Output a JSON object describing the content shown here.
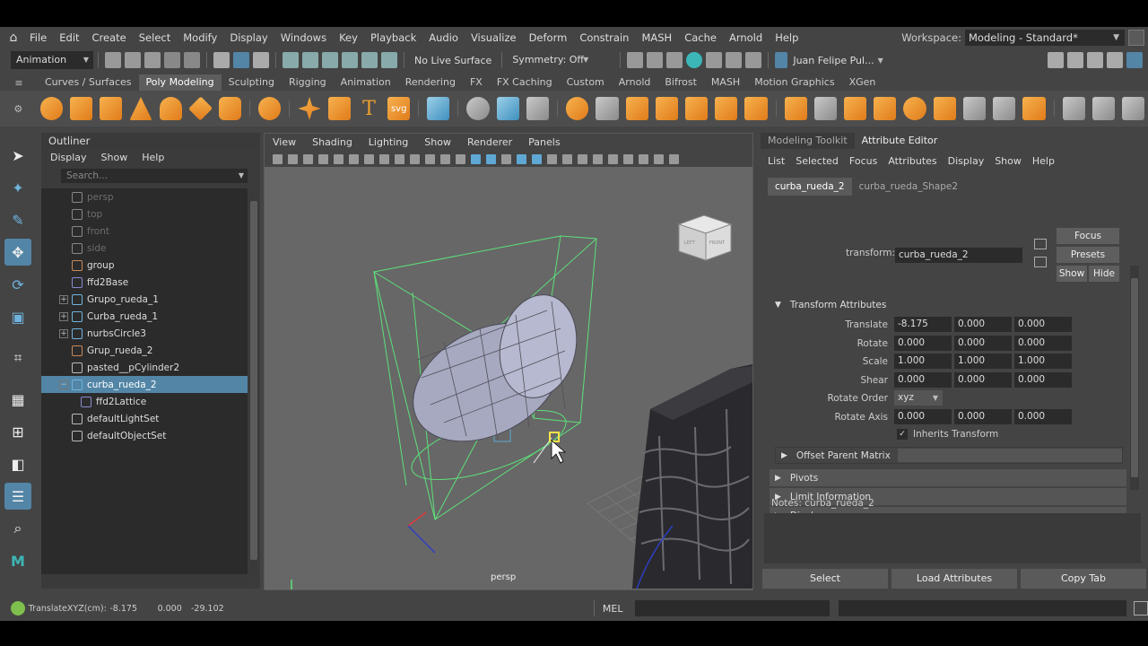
{
  "menubar": {
    "items": [
      "File",
      "Edit",
      "Create",
      "Select",
      "Modify",
      "Display",
      "Windows",
      "Key",
      "Playback",
      "Audio",
      "Visualize",
      "Deform",
      "Constrain",
      "MASH",
      "Cache",
      "Arnold",
      "Help"
    ],
    "workspace_label": "Workspace:",
    "workspace_value": "Modeling - Standard*"
  },
  "statusline": {
    "mode": "Animation",
    "live_surface": "No Live Surface",
    "symmetry": "Symmetry: Off",
    "user": "Juan Felipe Pul..."
  },
  "shelf": {
    "tabs": [
      "Curves / Surfaces",
      "Poly Modeling",
      "Sculpting",
      "Rigging",
      "Animation",
      "Rendering",
      "FX",
      "FX Caching",
      "Custom",
      "Arnold",
      "Bifrost",
      "MASH",
      "Motion Graphics",
      "XGen"
    ],
    "active_tab": "Poly Modeling",
    "t_glyph": "T",
    "svg_glyph": "svg"
  },
  "outliner": {
    "title": "Outliner",
    "menus": [
      "Display",
      "Show",
      "Help"
    ],
    "search_placeholder": "Search...",
    "nodes": [
      {
        "label": "persp",
        "dim": true
      },
      {
        "label": "top",
        "dim": true
      },
      {
        "label": "front",
        "dim": true
      },
      {
        "label": "side",
        "dim": true
      },
      {
        "label": "group"
      },
      {
        "label": "ffd2Base"
      },
      {
        "label": "Grupo_rueda_1",
        "expand": "+"
      },
      {
        "label": "Curba_rueda_1",
        "expand": "+"
      },
      {
        "label": "nurbsCircle3",
        "expand": "+"
      },
      {
        "label": "Grup_rueda_2"
      },
      {
        "label": "pasted__pCylinder2"
      },
      {
        "label": "curba_rueda_2",
        "selected": true,
        "expand": "−"
      },
      {
        "label": "ffd2Lattice",
        "child": true
      },
      {
        "label": "defaultLightSet"
      },
      {
        "label": "defaultObjectSet"
      }
    ]
  },
  "viewport": {
    "menus": [
      "View",
      "Shading",
      "Lighting",
      "Show",
      "Renderer",
      "Panels"
    ],
    "camera": "persp",
    "viewcube_left": "LEFT",
    "viewcube_front": "FRONT"
  },
  "attribute_editor": {
    "tabs": [
      "Modeling Toolkit",
      "Attribute Editor"
    ],
    "active_tab": "Attribute Editor",
    "menus": [
      "List",
      "Selected",
      "Focus",
      "Attributes",
      "Display",
      "Show",
      "Help"
    ],
    "node_tabs": [
      "curba_rueda_2",
      "curba_rueda_Shape2"
    ],
    "transform_label": "transform:",
    "transform_value": "curba_rueda_2",
    "btn_focus": "Focus",
    "btn_presets": "Presets",
    "btn_show": "Show",
    "btn_hide": "Hide",
    "section": "Transform Attributes",
    "translate_label": "Translate",
    "translate": [
      "-8.175",
      "0.000",
      "0.000"
    ],
    "rotate_label": "Rotate",
    "rotate": [
      "0.000",
      "0.000",
      "0.000"
    ],
    "scale_label": "Scale",
    "scale": [
      "1.000",
      "1.000",
      "1.000"
    ],
    "shear_label": "Shear",
    "shear": [
      "0.000",
      "0.000",
      "0.000"
    ],
    "rotate_order_label": "Rotate Order",
    "rotate_order": "xyz",
    "rotate_axis_label": "Rotate Axis",
    "rotate_axis": [
      "0.000",
      "0.000",
      "0.000"
    ],
    "inherits": "Inherits Transform",
    "offset_parent": "Offset Parent Matrix",
    "collapsed": [
      "Pivots",
      "Limit Information",
      "Display"
    ],
    "notes_label": "Notes:  curba_rueda_2",
    "bottom_buttons": [
      "Select",
      "Load Attributes",
      "Copy Tab"
    ]
  },
  "commandline": {
    "label": "TranslateXYZ(cm):",
    "values": [
      "-8.175",
      "0.000",
      "-29.102"
    ],
    "lang": "MEL"
  }
}
